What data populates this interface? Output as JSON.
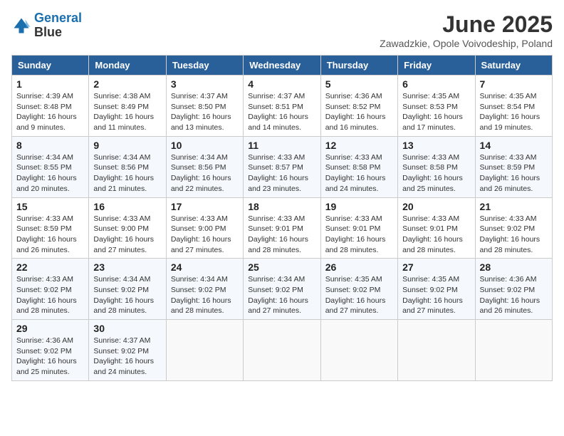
{
  "header": {
    "logo": {
      "line1": "General",
      "line2": "Blue"
    },
    "title": "June 2025",
    "subtitle": "Zawadzkie, Opole Voivodeship, Poland"
  },
  "calendar": {
    "days_of_week": [
      "Sunday",
      "Monday",
      "Tuesday",
      "Wednesday",
      "Thursday",
      "Friday",
      "Saturday"
    ],
    "weeks": [
      [
        {
          "day": "1",
          "info": "Sunrise: 4:39 AM\nSunset: 8:48 PM\nDaylight: 16 hours\nand 9 minutes."
        },
        {
          "day": "2",
          "info": "Sunrise: 4:38 AM\nSunset: 8:49 PM\nDaylight: 16 hours\nand 11 minutes."
        },
        {
          "day": "3",
          "info": "Sunrise: 4:37 AM\nSunset: 8:50 PM\nDaylight: 16 hours\nand 13 minutes."
        },
        {
          "day": "4",
          "info": "Sunrise: 4:37 AM\nSunset: 8:51 PM\nDaylight: 16 hours\nand 14 minutes."
        },
        {
          "day": "5",
          "info": "Sunrise: 4:36 AM\nSunset: 8:52 PM\nDaylight: 16 hours\nand 16 minutes."
        },
        {
          "day": "6",
          "info": "Sunrise: 4:35 AM\nSunset: 8:53 PM\nDaylight: 16 hours\nand 17 minutes."
        },
        {
          "day": "7",
          "info": "Sunrise: 4:35 AM\nSunset: 8:54 PM\nDaylight: 16 hours\nand 19 minutes."
        }
      ],
      [
        {
          "day": "8",
          "info": "Sunrise: 4:34 AM\nSunset: 8:55 PM\nDaylight: 16 hours\nand 20 minutes."
        },
        {
          "day": "9",
          "info": "Sunrise: 4:34 AM\nSunset: 8:56 PM\nDaylight: 16 hours\nand 21 minutes."
        },
        {
          "day": "10",
          "info": "Sunrise: 4:34 AM\nSunset: 8:56 PM\nDaylight: 16 hours\nand 22 minutes."
        },
        {
          "day": "11",
          "info": "Sunrise: 4:33 AM\nSunset: 8:57 PM\nDaylight: 16 hours\nand 23 minutes."
        },
        {
          "day": "12",
          "info": "Sunrise: 4:33 AM\nSunset: 8:58 PM\nDaylight: 16 hours\nand 24 minutes."
        },
        {
          "day": "13",
          "info": "Sunrise: 4:33 AM\nSunset: 8:58 PM\nDaylight: 16 hours\nand 25 minutes."
        },
        {
          "day": "14",
          "info": "Sunrise: 4:33 AM\nSunset: 8:59 PM\nDaylight: 16 hours\nand 26 minutes."
        }
      ],
      [
        {
          "day": "15",
          "info": "Sunrise: 4:33 AM\nSunset: 8:59 PM\nDaylight: 16 hours\nand 26 minutes."
        },
        {
          "day": "16",
          "info": "Sunrise: 4:33 AM\nSunset: 9:00 PM\nDaylight: 16 hours\nand 27 minutes."
        },
        {
          "day": "17",
          "info": "Sunrise: 4:33 AM\nSunset: 9:00 PM\nDaylight: 16 hours\nand 27 minutes."
        },
        {
          "day": "18",
          "info": "Sunrise: 4:33 AM\nSunset: 9:01 PM\nDaylight: 16 hours\nand 28 minutes."
        },
        {
          "day": "19",
          "info": "Sunrise: 4:33 AM\nSunset: 9:01 PM\nDaylight: 16 hours\nand 28 minutes."
        },
        {
          "day": "20",
          "info": "Sunrise: 4:33 AM\nSunset: 9:01 PM\nDaylight: 16 hours\nand 28 minutes."
        },
        {
          "day": "21",
          "info": "Sunrise: 4:33 AM\nSunset: 9:02 PM\nDaylight: 16 hours\nand 28 minutes."
        }
      ],
      [
        {
          "day": "22",
          "info": "Sunrise: 4:33 AM\nSunset: 9:02 PM\nDaylight: 16 hours\nand 28 minutes."
        },
        {
          "day": "23",
          "info": "Sunrise: 4:34 AM\nSunset: 9:02 PM\nDaylight: 16 hours\nand 28 minutes."
        },
        {
          "day": "24",
          "info": "Sunrise: 4:34 AM\nSunset: 9:02 PM\nDaylight: 16 hours\nand 28 minutes."
        },
        {
          "day": "25",
          "info": "Sunrise: 4:34 AM\nSunset: 9:02 PM\nDaylight: 16 hours\nand 27 minutes."
        },
        {
          "day": "26",
          "info": "Sunrise: 4:35 AM\nSunset: 9:02 PM\nDaylight: 16 hours\nand 27 minutes."
        },
        {
          "day": "27",
          "info": "Sunrise: 4:35 AM\nSunset: 9:02 PM\nDaylight: 16 hours\nand 27 minutes."
        },
        {
          "day": "28",
          "info": "Sunrise: 4:36 AM\nSunset: 9:02 PM\nDaylight: 16 hours\nand 26 minutes."
        }
      ],
      [
        {
          "day": "29",
          "info": "Sunrise: 4:36 AM\nSunset: 9:02 PM\nDaylight: 16 hours\nand 25 minutes."
        },
        {
          "day": "30",
          "info": "Sunrise: 4:37 AM\nSunset: 9:02 PM\nDaylight: 16 hours\nand 24 minutes."
        },
        {
          "day": "",
          "info": ""
        },
        {
          "day": "",
          "info": ""
        },
        {
          "day": "",
          "info": ""
        },
        {
          "day": "",
          "info": ""
        },
        {
          "day": "",
          "info": ""
        }
      ]
    ]
  }
}
